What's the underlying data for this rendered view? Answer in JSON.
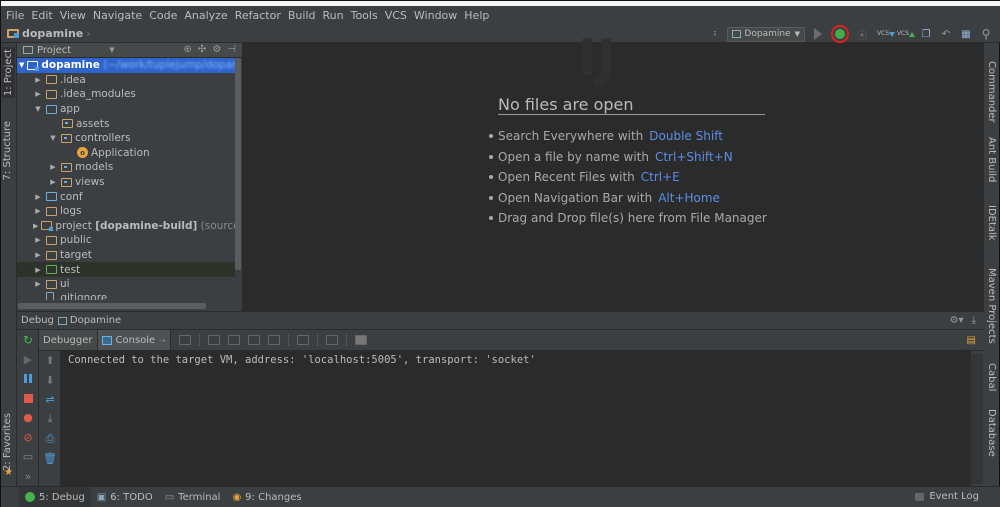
{
  "menubar": {
    "items": [
      "File",
      "Edit",
      "View",
      "Navigate",
      "Code",
      "Analyze",
      "Refactor",
      "Build",
      "Run",
      "Tools",
      "VCS",
      "Window",
      "Help"
    ]
  },
  "navbar": {
    "breadcrumb": "dopamine"
  },
  "toolbar": {
    "run_config": "Dopamine",
    "buttons": [
      "run-button",
      "debug-button",
      "attach-button",
      "vcs-update-button",
      "vcs-commit-button",
      "history-button",
      "revert-button",
      "project-structure-button",
      "search-button"
    ],
    "vcs_label": "VCS",
    "highlight_color": "#e02020"
  },
  "left_strip": {
    "tabs": [
      "1: Project",
      "7: Structure",
      "2: Favorites"
    ]
  },
  "right_strip": {
    "tabs": [
      "Commander",
      "Ant Build",
      "IDEtalk",
      "Maven Projects",
      "Cabal",
      "Database"
    ]
  },
  "project": {
    "title": "Project",
    "tree": [
      {
        "label": "dopamine",
        "suffix": "(~/work/tuplejump/dopamine",
        "depth": 0,
        "expanded": true,
        "type": "module",
        "selected": true
      },
      {
        "label": ".idea",
        "depth": 1,
        "expanded": false,
        "type": "folder"
      },
      {
        "label": ".idea_modules",
        "depth": 1,
        "expanded": false,
        "type": "folder"
      },
      {
        "label": "app",
        "depth": 1,
        "expanded": true,
        "type": "folder-blue"
      },
      {
        "label": "assets",
        "depth": 2,
        "type": "package"
      },
      {
        "label": "controllers",
        "depth": 2,
        "expanded": true,
        "type": "package"
      },
      {
        "label": "Application",
        "depth": 3,
        "type": "class"
      },
      {
        "label": "models",
        "depth": 2,
        "expanded": false,
        "type": "package"
      },
      {
        "label": "views",
        "depth": 2,
        "expanded": false,
        "type": "package"
      },
      {
        "label": "conf",
        "depth": 1,
        "expanded": false,
        "type": "folder-blue"
      },
      {
        "label": "logs",
        "depth": 1,
        "expanded": false,
        "type": "folder"
      },
      {
        "label": "project",
        "bold": "[dopamine-build]",
        "suffix": "(sources",
        "depth": 1,
        "expanded": false,
        "type": "module"
      },
      {
        "label": "public",
        "depth": 1,
        "expanded": false,
        "type": "folder"
      },
      {
        "label": "target",
        "depth": 1,
        "expanded": false,
        "type": "folder"
      },
      {
        "label": "test",
        "depth": 1,
        "expanded": false,
        "type": "folder-green",
        "highlighted": true
      },
      {
        "label": "ui",
        "depth": 1,
        "expanded": false,
        "type": "folder"
      },
      {
        "label": ".gitignore",
        "depth": 1,
        "type": "file"
      }
    ]
  },
  "editor": {
    "empty_title": "No files are open",
    "tips": [
      {
        "text": "Search Everywhere with",
        "shortcut": "Double Shift"
      },
      {
        "text": "Open a file by name with",
        "shortcut": "Ctrl+Shift+N"
      },
      {
        "text": "Open Recent Files with",
        "shortcut": "Ctrl+E"
      },
      {
        "text": "Open Navigation Bar with",
        "shortcut": "Alt+Home"
      },
      {
        "text": "Drag and Drop file(s) here from File Manager",
        "shortcut": ""
      }
    ]
  },
  "debug": {
    "title": "Debug",
    "config": "Dopamine",
    "tabs": [
      {
        "label": "Debugger",
        "active": false
      },
      {
        "label": "Console",
        "active": true
      }
    ],
    "console_lines": [
      "Connected to the target VM, address: 'localhost:5005', transport: 'socket'"
    ]
  },
  "statusbar": {
    "tabs": [
      {
        "label": "5: Debug",
        "active": true
      },
      {
        "label": "6: TODO",
        "active": false
      },
      {
        "label": "Terminal",
        "active": false
      },
      {
        "label": "9: Changes",
        "active": false
      }
    ],
    "event_log": "Event Log"
  }
}
